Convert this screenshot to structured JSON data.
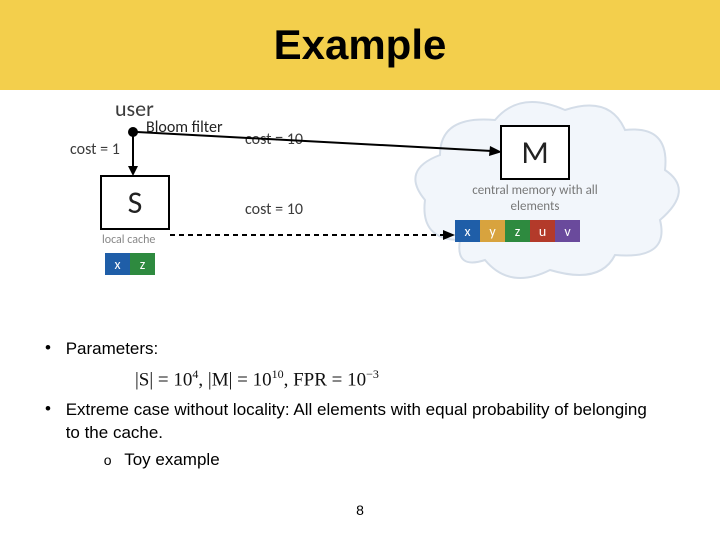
{
  "title": "Example",
  "diagram": {
    "user": "user",
    "bloom_filter": "Bloom filter",
    "cost_local": "cost = 1",
    "cost_remote_a": "cost = 10",
    "cost_remote_b": "cost = 10",
    "s_label": "S",
    "local_cache": "local cache",
    "m_label": "M",
    "central_memory": "central memory with all elements",
    "s_cells": [
      "x",
      "z"
    ],
    "m_cells": [
      "x",
      "y",
      "z",
      "u",
      "v"
    ]
  },
  "bullets": {
    "parameters_label": "Parameters:",
    "formula_html": "|S| = 10<sup>4</sup>, |M| = 10<sup>10</sup>, FPR = 10<sup>−3</sup>",
    "extreme_case": "Extreme case without locality: All elements with equal probability of belonging to the cache.",
    "toy_example": "Toy example"
  },
  "page_number": "8"
}
